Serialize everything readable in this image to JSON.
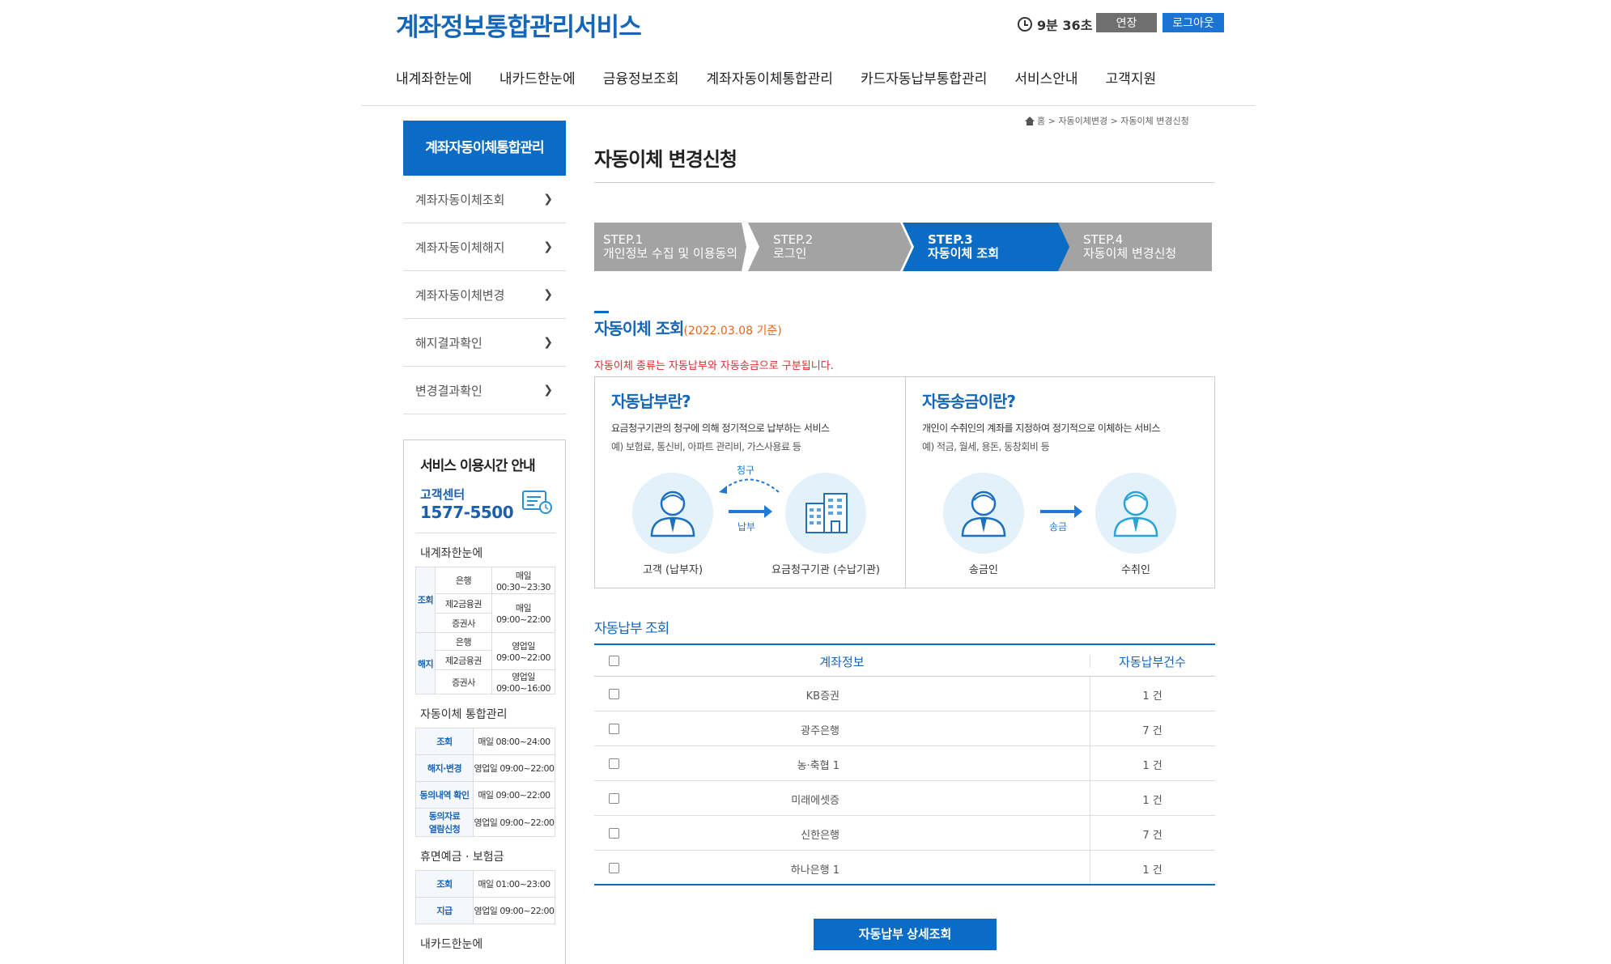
{
  "header": {
    "logo": "계좌정보통합관리서비스",
    "timer": "9분 36초",
    "extend_label": "연장",
    "logout_label": "로그아웃"
  },
  "gnb": [
    "내계좌한눈에",
    "내카드한눈에",
    "금융정보조회",
    "계좌자동이체통합관리",
    "카드자동납부통합관리",
    "서비스안내",
    "고객지원"
  ],
  "sidebar": {
    "title": "계좌자동이체통합관리",
    "items": [
      "계좌자동이체조회",
      "계좌자동이체해지",
      "계좌자동이체변경",
      "해지결과확인",
      "변경결과확인"
    ],
    "chevron": "›"
  },
  "service_hours": {
    "title": "서비스 이용시간 안내",
    "cc_label": "고객센터",
    "cc_number": "1577-5500",
    "my_account": {
      "heading": "내계좌한눈에",
      "rows": [
        {
          "cat": "조회",
          "org": "은행",
          "time1": "매일",
          "time2": "00:30~23:30"
        },
        {
          "org": "제2금융권",
          "time1": "매일",
          "time2": "09:00~22:00"
        },
        {
          "org": "증권사"
        },
        {
          "cat": "해지",
          "org": "은행",
          "time1": "영업일",
          "time2": "09:00~22:00"
        },
        {
          "org": "제2금융권"
        },
        {
          "org": "증권사",
          "time1": "영업일",
          "time2": "09:00~16:00"
        }
      ]
    },
    "auto_transfer": {
      "heading": "자동이체 통합관리",
      "rows": [
        {
          "label": "조회",
          "time": "매일 08:00~24:00"
        },
        {
          "label": "해지·변경",
          "time": "영업일 09:00~22:00"
        },
        {
          "label": "동의내역 확인",
          "time": "매일 09:00~22:00"
        },
        {
          "label1": "동의자료",
          "label2": "열람신청",
          "time": "영업일 09:00~22:00"
        }
      ]
    },
    "dormant": {
      "heading": "휴면예금 · 보험금",
      "rows": [
        {
          "label": "조회",
          "time": "매일 01:00~23:00"
        },
        {
          "label": "지급",
          "time": "영업일 09:00~22:00"
        }
      ]
    },
    "next_heading": "내카드한눈에"
  },
  "breadcrumb": [
    "홈",
    ">",
    "자동이체변경",
    ">",
    "자동이체 변경신청"
  ],
  "page_title": "자동이체 변경신청",
  "steps": [
    {
      "num": "STEP.1",
      "label": "개인정보 수집 및 이용동의"
    },
    {
      "num": "STEP.2",
      "label": "로그인"
    },
    {
      "num": "STEP.3",
      "label": "자동이체 조회"
    },
    {
      "num": "STEP.4",
      "label": "자동이체 변경신청"
    }
  ],
  "section": {
    "title": "자동이체 조회",
    "date": "(2022.03.08 기준)",
    "notice": "자동이체 종류는 자동납부와 자동송금으로 구분됩니다."
  },
  "info": {
    "left": {
      "title": "자동납부란?",
      "desc1": "요금청구기관의 청구에 의해 정기적으로 납부하는 서비스",
      "desc2": "예) 보험료, 통신비, 아파트 관리비, 가스사용료 등",
      "cap1": "고객 (납부자)",
      "cap2": "요금청구기관 (수납기관)",
      "arrow_top": "청구",
      "arrow_bottom": "납부"
    },
    "right": {
      "title": "자동송금이란?",
      "desc1": "개인이 수취인의 계좌를 지정하여 정기적으로 이체하는 서비스",
      "desc2": "예) 적금, 월세, 용돈, 동창회비 등",
      "cap1": "송금인",
      "cap2": "수취인",
      "arrow_label": "송금"
    }
  },
  "table": {
    "title": "자동납부 조회",
    "headers": [
      "계좌정보",
      "자동납부건수"
    ],
    "rows": [
      {
        "bank": "KB증권",
        "count": "1 건"
      },
      {
        "bank": "광주은행",
        "count": "7 건"
      },
      {
        "bank": "농·축협 1",
        "count": "1 건"
      },
      {
        "bank": "미래에셋증",
        "count": "1 건"
      },
      {
        "bank": "신한은행",
        "count": "7 건"
      },
      {
        "bank": "하나은행 1",
        "count": "1 건"
      }
    ]
  },
  "detail_button": "자동납부 상세조회",
  "colors": {
    "primary": "#0a6cc4",
    "step_inactive": "#a3a3a3",
    "notice": "#e12c2c",
    "date": "#e8641b"
  }
}
